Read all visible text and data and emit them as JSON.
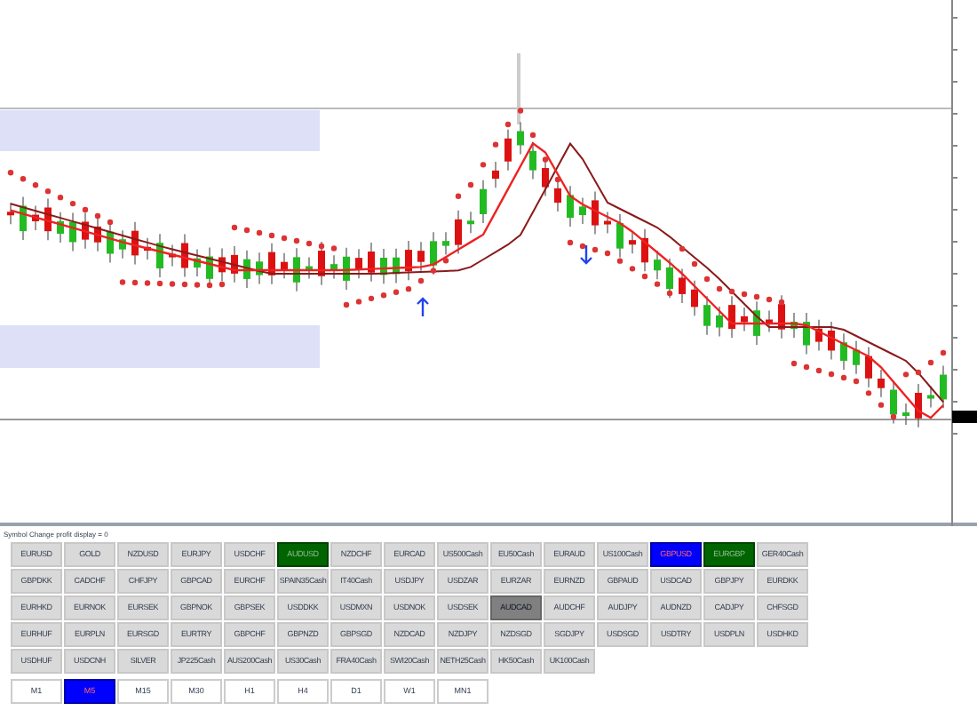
{
  "chart": {
    "kind": "candles"
  },
  "panel": {
    "title": "Symbol Change profit display = 0",
    "symbols": [
      {
        "label": "EURUSD",
        "color": "#d9d9d9"
      },
      {
        "label": "GOLD",
        "color": "#d9d9d9"
      },
      {
        "label": "NZDUSD",
        "color": "#d9d9d9"
      },
      {
        "label": "EURJPY",
        "color": "#d9d9d9"
      },
      {
        "label": "USDCHF",
        "color": "#d9d9d9"
      },
      {
        "label": "AUDUSD",
        "color": "#006400"
      },
      {
        "label": "NZDCHF",
        "color": "#d9d9d9"
      },
      {
        "label": "EURCAD",
        "color": "#d9d9d9"
      },
      {
        "label": "US500Cash",
        "color": "#d9d9d9"
      },
      {
        "label": "EU50Cash",
        "color": "#d9d9d9"
      },
      {
        "label": "EURAUD",
        "color": "#d9d9d9"
      },
      {
        "label": "US100Cash",
        "color": "#d9d9d9"
      },
      {
        "label": "GBPUSD",
        "color": "#0000ff"
      },
      {
        "label": "EURGBP",
        "color": "#006400"
      },
      {
        "label": "GER40Cash",
        "color": "#d9d9d9"
      },
      {
        "label": "GBPDKK",
        "color": "#d9d9d9"
      },
      {
        "label": "CADCHF",
        "color": "#d9d9d9"
      },
      {
        "label": "CHFJPY",
        "color": "#d9d9d9"
      },
      {
        "label": "GBPCAD",
        "color": "#d9d9d9"
      },
      {
        "label": "EURCHF",
        "color": "#d9d9d9"
      },
      {
        "label": "SPAIN35Cash",
        "color": "#d9d9d9"
      },
      {
        "label": "IT40Cash",
        "color": "#d9d9d9"
      },
      {
        "label": "USDJPY",
        "color": "#d9d9d9"
      },
      {
        "label": "USDZAR",
        "color": "#d9d9d9"
      },
      {
        "label": "EURZAR",
        "color": "#d9d9d9"
      },
      {
        "label": "EURNZD",
        "color": "#d9d9d9"
      },
      {
        "label": "GBPAUD",
        "color": "#d9d9d9"
      },
      {
        "label": "USDCAD",
        "color": "#d9d9d9"
      },
      {
        "label": "GBPJPY",
        "color": "#d9d9d9"
      },
      {
        "label": "EURDKK",
        "color": "#d9d9d9"
      },
      {
        "label": "EURHKD",
        "color": "#d9d9d9"
      },
      {
        "label": "EURNOK",
        "color": "#d9d9d9"
      },
      {
        "label": "EURSEK",
        "color": "#d9d9d9"
      },
      {
        "label": "GBPNOK",
        "color": "#d9d9d9"
      },
      {
        "label": "GBPSEK",
        "color": "#d9d9d9"
      },
      {
        "label": "USDDKK",
        "color": "#d9d9d9"
      },
      {
        "label": "USDMXN",
        "color": "#d9d9d9"
      },
      {
        "label": "USDNOK",
        "color": "#d9d9d9"
      },
      {
        "label": "USDSEK",
        "color": "#d9d9d9"
      },
      {
        "label": "AUDCAD",
        "color": "#808080"
      },
      {
        "label": "AUDCHF",
        "color": "#d9d9d9"
      },
      {
        "label": "AUDJPY",
        "color": "#d9d9d9"
      },
      {
        "label": "AUDNZD",
        "color": "#d9d9d9"
      },
      {
        "label": "CADJPY",
        "color": "#d9d9d9"
      },
      {
        "label": "CHFSGD",
        "color": "#d9d9d9"
      },
      {
        "label": "EURHUF",
        "color": "#d9d9d9"
      },
      {
        "label": "EURPLN",
        "color": "#d9d9d9"
      },
      {
        "label": "EURSGD",
        "color": "#d9d9d9"
      },
      {
        "label": "EURTRY",
        "color": "#d9d9d9"
      },
      {
        "label": "GBPCHF",
        "color": "#d9d9d9"
      },
      {
        "label": "GBPNZD",
        "color": "#d9d9d9"
      },
      {
        "label": "GBPSGD",
        "color": "#d9d9d9"
      },
      {
        "label": "NZDCAD",
        "color": "#d9d9d9"
      },
      {
        "label": "NZDJPY",
        "color": "#d9d9d9"
      },
      {
        "label": "NZDSGD",
        "color": "#d9d9d9"
      },
      {
        "label": "SGDJPY",
        "color": "#d9d9d9"
      },
      {
        "label": "USDSGD",
        "color": "#d9d9d9"
      },
      {
        "label": "USDTRY",
        "color": "#d9d9d9"
      },
      {
        "label": "USDPLN",
        "color": "#d9d9d9"
      },
      {
        "label": "USDHKD",
        "color": "#d9d9d9"
      },
      {
        "label": "USDHUF",
        "color": "#d9d9d9"
      },
      {
        "label": "USDCNH",
        "color": "#d9d9d9"
      },
      {
        "label": "SILVER",
        "color": "#d9d9d9"
      },
      {
        "label": "JP225Cash",
        "color": "#d9d9d9"
      },
      {
        "label": "AUS200Cash",
        "color": "#d9d9d9"
      },
      {
        "label": "US30Cash",
        "color": "#d9d9d9"
      },
      {
        "label": "FRA40Cash",
        "color": "#d9d9d9"
      },
      {
        "label": "SWI20Cash",
        "color": "#d9d9d9"
      },
      {
        "label": "NETH25Cash",
        "color": "#d9d9d9"
      },
      {
        "label": "HK50Cash",
        "color": "#d9d9d9"
      },
      {
        "label": "UK100Cash",
        "color": "#d9d9d9"
      }
    ],
    "timeframes": [
      {
        "label": "M1",
        "selected": false
      },
      {
        "label": "M5",
        "selected": true
      },
      {
        "label": "M15",
        "selected": false
      },
      {
        "label": "M30",
        "selected": false
      },
      {
        "label": "H1",
        "selected": false
      },
      {
        "label": "H4",
        "selected": false
      },
      {
        "label": "D1",
        "selected": false
      },
      {
        "label": "W1",
        "selected": false
      },
      {
        "label": "MN1",
        "selected": false
      }
    ]
  }
}
